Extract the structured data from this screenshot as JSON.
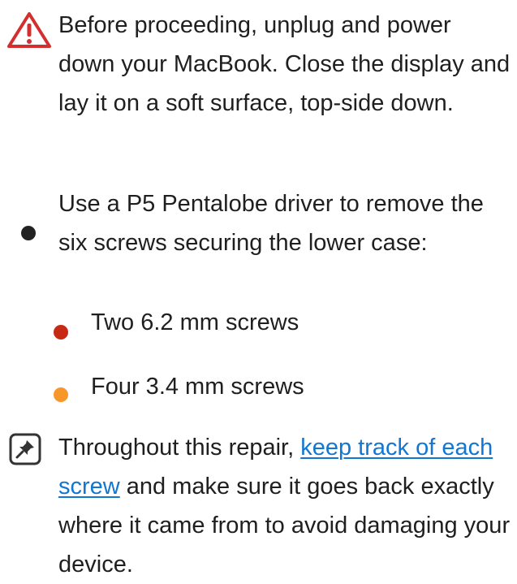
{
  "warning": {
    "icon": "warning-triangle-icon",
    "color": "#d32f2f",
    "text": "Before proceeding, unplug and power down your MacBook. Close the display and lay it on a soft surface, top-side down."
  },
  "bullet": {
    "icon": "black-bullet-icon",
    "color": "#222222",
    "text": "Use a P5 Pentalobe driver to remove the six screws securing the lower case:",
    "subitems": [
      {
        "icon": "red-bullet-icon",
        "color": "#c62a12",
        "text": "Two 6.2 mm screws"
      },
      {
        "icon": "orange-bullet-icon",
        "color": "#f7972b",
        "text": "Four 3.4 mm screws"
      }
    ]
  },
  "note": {
    "icon": "pin-icon",
    "text_before": "Throughout this repair, ",
    "link_text": "keep track of each screw",
    "text_after": " and make sure it goes back exactly where it came from to avoid damaging your device."
  }
}
